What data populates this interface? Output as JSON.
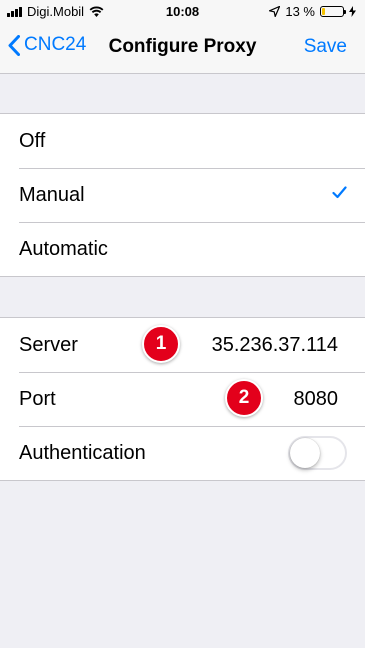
{
  "status_bar": {
    "carrier": "Digi.Mobil",
    "time": "10:08",
    "battery_text": "13 %",
    "battery_level": 0.13,
    "battery_color": "#f5c300",
    "icons": [
      "signal-icon",
      "wifi-icon",
      "location-icon",
      "battery-icon",
      "charging-icon"
    ]
  },
  "nav": {
    "back_label": "CNC24",
    "title": "Configure Proxy",
    "save_label": "Save",
    "accent": "#007aff"
  },
  "proxy_modes": [
    {
      "label": "Off",
      "selected": false
    },
    {
      "label": "Manual",
      "selected": true
    },
    {
      "label": "Automatic",
      "selected": false
    }
  ],
  "manual_settings": {
    "server_label": "Server",
    "server_value": "35.236.37.114",
    "port_label": "Port",
    "port_value": "8080",
    "auth_label": "Authentication",
    "auth_enabled": false
  },
  "annotations": {
    "badge_1": "1",
    "badge_2": "2",
    "badge_color": "#e3001b"
  }
}
